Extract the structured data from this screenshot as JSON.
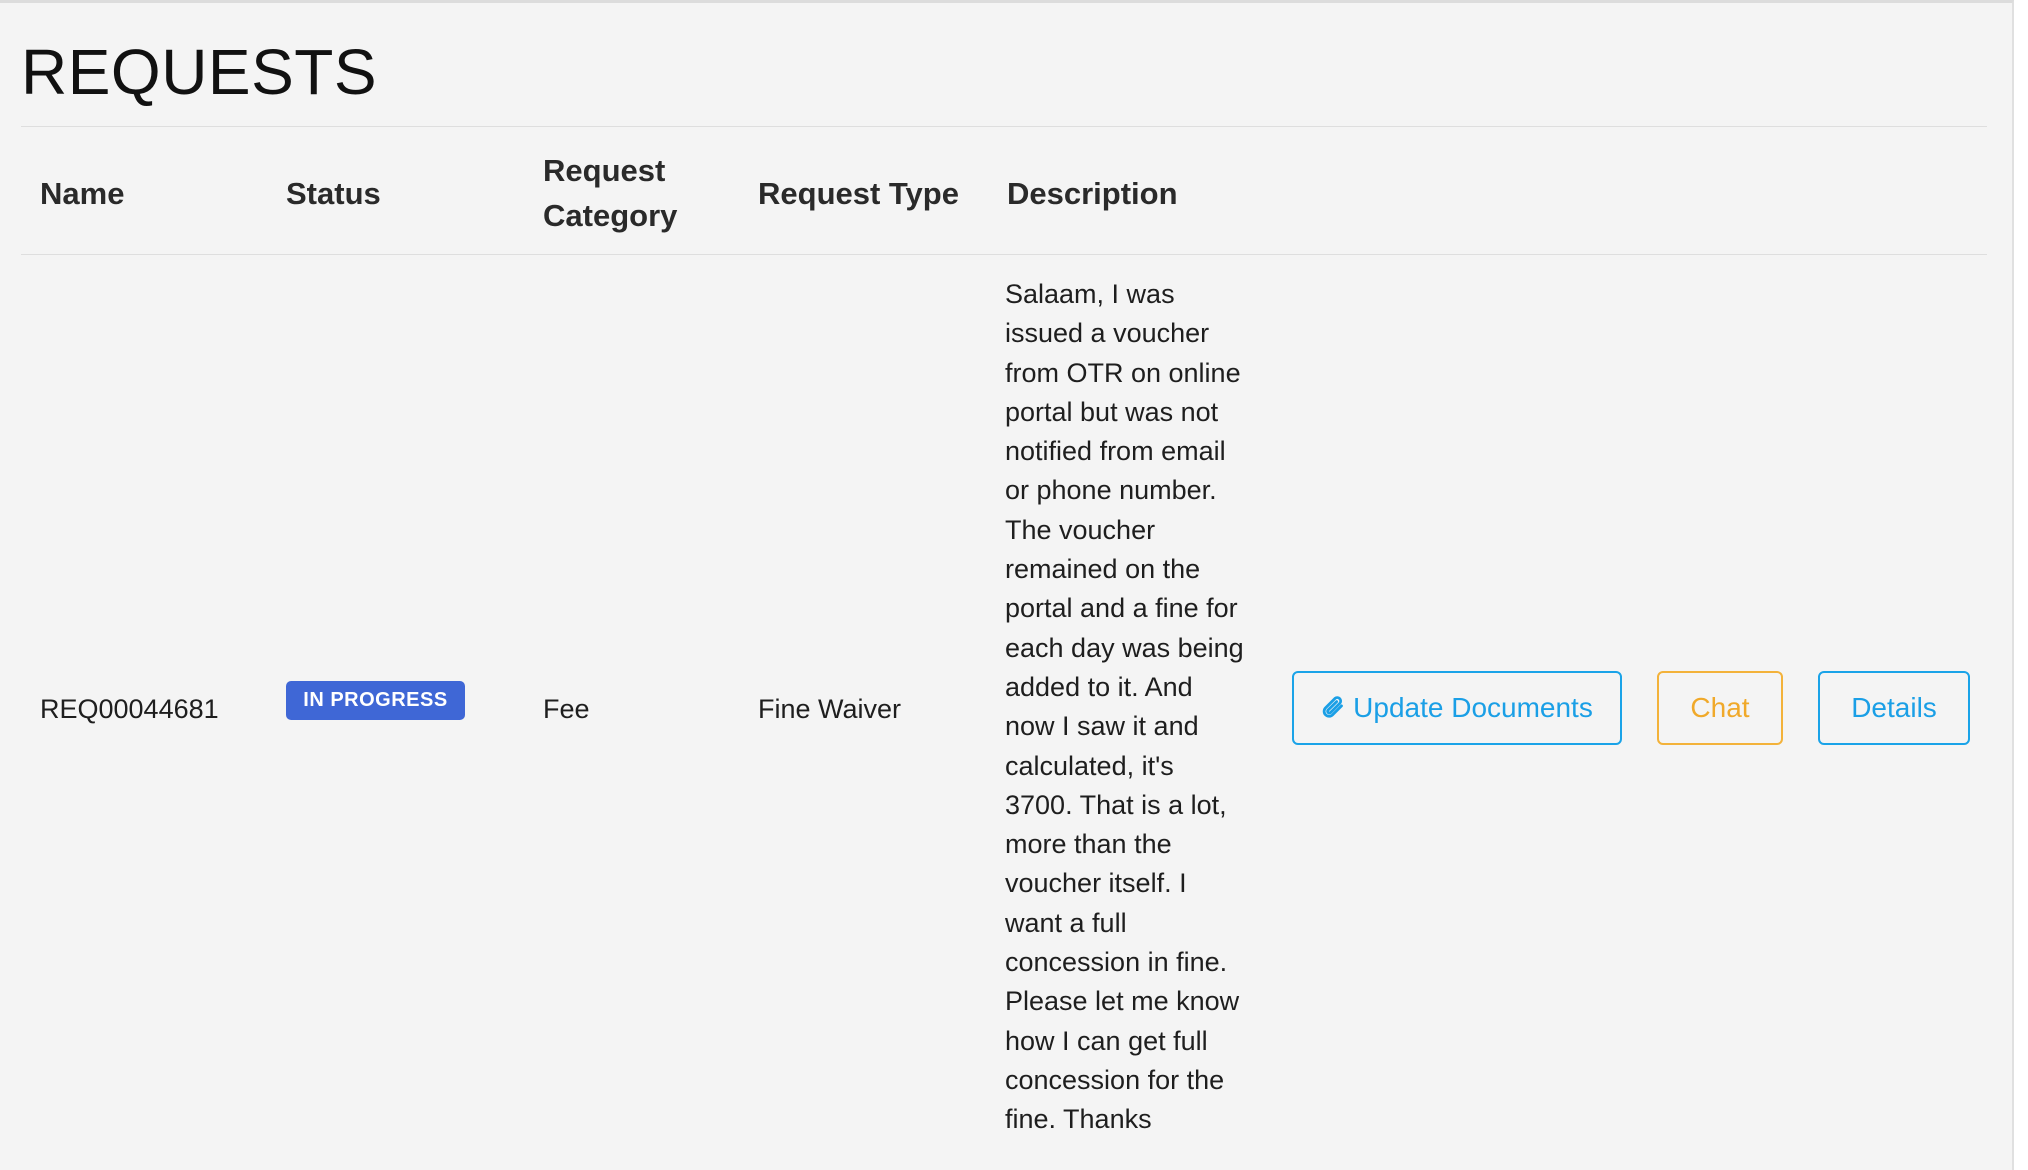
{
  "page": {
    "title": "REQUESTS"
  },
  "table": {
    "columns": [
      "Name",
      "Status",
      "Request\nCategory",
      "Request Type",
      "Description"
    ],
    "rows": [
      {
        "name": "REQ00044681",
        "status": "IN PROGRESS",
        "category": "Fee",
        "type": "Fine Waiver",
        "description": "Salaam, I was\nissued a voucher\nfrom OTR on online\nportal but was not\nnotified from email\nor phone number.\nThe voucher\nremained on the\nportal and a fine for\neach day was being\nadded to it. And\nnow I saw it and\ncalculated, it's\n3700. That is a lot,\nmore than the\nvoucher itself. I\nwant a full\nconcession in fine.\nPlease let me know\nhow I can get full\nconcession for the\nfine. Thanks",
        "actions": {
          "update_documents": "Update Documents",
          "chat": "Chat",
          "details": "Details"
        }
      }
    ]
  },
  "icons": {
    "update_documents": "paperclip-icon"
  },
  "colors": {
    "status_badge": "#3f67d6",
    "primary_outline": "#1aa3e8",
    "warning_outline": "#f3b23a",
    "panel_background": "#f4f4f4"
  }
}
